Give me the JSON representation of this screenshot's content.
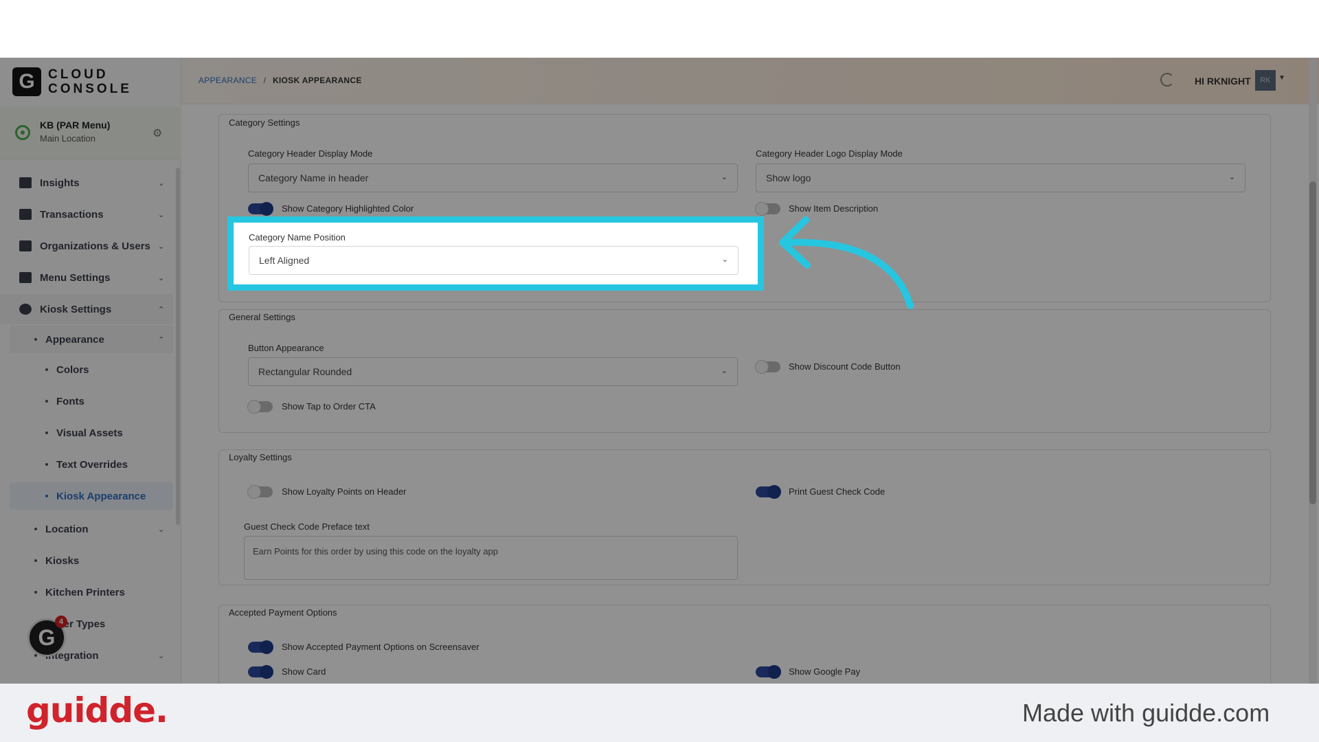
{
  "brand": {
    "logo_letter": "G",
    "logo_line1": "CLOUD",
    "logo_line2": "CONSOLE"
  },
  "location": {
    "name": "KB (PAR Menu)",
    "sub": "Main Location"
  },
  "nav": [
    {
      "label": "Insights",
      "icon": "chart-icon"
    },
    {
      "label": "Transactions",
      "icon": "receipt-icon"
    },
    {
      "label": "Organizations & Users",
      "icon": "org-icon"
    },
    {
      "label": "Menu Settings",
      "icon": "menu-icon"
    },
    {
      "label": "Kiosk Settings",
      "icon": "gear-icon"
    }
  ],
  "kiosk_sub": {
    "appearance": "Appearance",
    "appearance_children": [
      "Colors",
      "Fonts",
      "Visual Assets",
      "Text Overrides",
      "Kiosk Appearance"
    ],
    "others": [
      "Location",
      "Kiosks",
      "Kitchen Printers",
      "Order Types",
      "Integration"
    ]
  },
  "guidde_badge": "4",
  "header": {
    "crumb_link": "APPEARANCE",
    "crumb_sep": "/",
    "crumb_current": "KIOSK APPEARANCE",
    "greeting": "HI RKNIGHT",
    "avatar_initials": "RK"
  },
  "category_settings": {
    "title": "Category Settings",
    "header_display_mode_label": "Category Header Display Mode",
    "header_display_mode_value": "Category Name in header",
    "logo_display_mode_label": "Category Header Logo Display Mode",
    "logo_display_mode_value": "Show logo",
    "show_highlighted_color": "Show Category Highlighted Color",
    "show_item_description": "Show Item Description",
    "name_position_label": "Category Name Position",
    "name_position_value": "Left Aligned"
  },
  "general_settings": {
    "title": "General Settings",
    "button_appearance_label": "Button Appearance",
    "button_appearance_value": "Rectangular Rounded",
    "show_discount": "Show Discount Code Button",
    "show_tap_to_order": "Show Tap to Order CTA"
  },
  "loyalty_settings": {
    "title": "Loyalty Settings",
    "show_points_header": "Show Loyalty Points on Header",
    "print_guest_check": "Print Guest Check Code",
    "preface_label": "Guest Check Code Preface text",
    "preface_value": "Earn Points for this order by using this code on the loyalty app"
  },
  "payment_options": {
    "title": "Accepted Payment Options",
    "show_on_screensaver": "Show Accepted Payment Options on Screensaver",
    "show_card": "Show Card",
    "show_google_pay": "Show Google Pay"
  },
  "footer": {
    "brand": "guidde.",
    "made_with": "Made with guidde.com"
  },
  "colors": {
    "highlight": "#26c6e0",
    "accent": "#2f6fbf",
    "toggle_on": "#2d4b9e",
    "brand_red": "#d0232b"
  }
}
